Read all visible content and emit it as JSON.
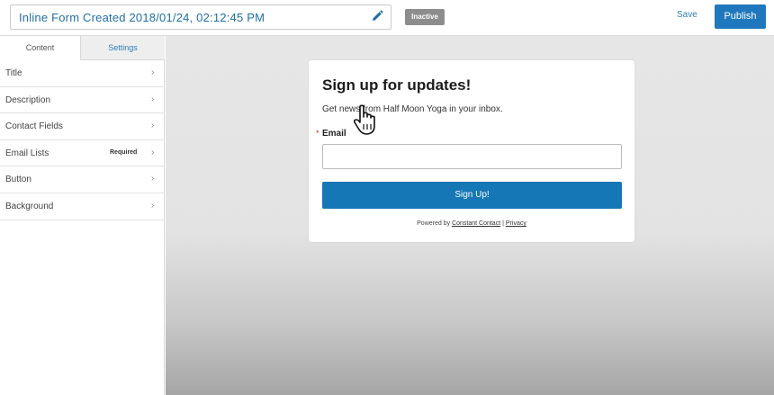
{
  "header": {
    "form_title": "Inline Form Created 2018/01/24, 02:12:45 PM",
    "status_badge": "Inactive",
    "save_label": "Save",
    "publish_label": "Publish"
  },
  "sidebar": {
    "tabs": [
      {
        "label": "Content"
      },
      {
        "label": "Settings"
      }
    ],
    "items": [
      {
        "label": "Title",
        "note": ""
      },
      {
        "label": "Description",
        "note": ""
      },
      {
        "label": "Contact Fields",
        "note": ""
      },
      {
        "label": "Email Lists",
        "note": "Required"
      },
      {
        "label": "Button",
        "note": ""
      },
      {
        "label": "Background",
        "note": ""
      }
    ]
  },
  "form_preview": {
    "heading": "Sign up for updates!",
    "description": "Get news from Half Moon Yoga in your inbox.",
    "required_marker": "*",
    "email_label": "Email",
    "email_value": "",
    "button_label": "Sign Up!",
    "powered_prefix": "Powered by",
    "powered_link": "Constant Contact",
    "separator": "|",
    "privacy_link": "Privacy"
  },
  "colors": {
    "accent": "#1f78bd",
    "badge": "#8d8d8d",
    "canvas": "#e6e6e6"
  },
  "icons": {
    "edit": "pencil-icon",
    "chevron": "chevron-right-icon",
    "cursor": "hand-pointer-cursor-icon"
  }
}
